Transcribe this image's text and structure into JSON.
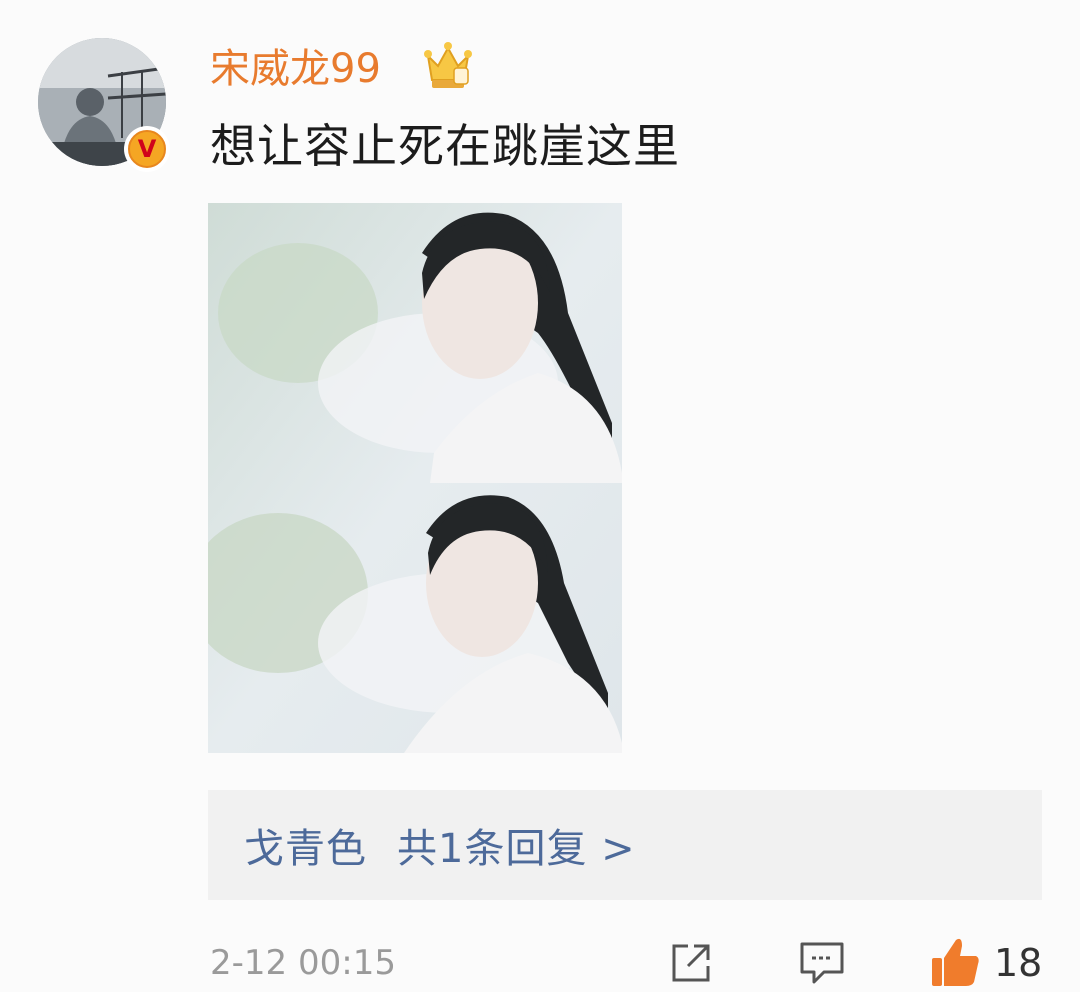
{
  "comment": {
    "username": "宋威龙99",
    "text": "想让容止死在跳崖这里",
    "verified_mark": "V"
  },
  "reply": {
    "author": "戈青色",
    "summary": "共1条回复 >"
  },
  "footer": {
    "timestamp": "2-12 00:15",
    "like_count": "18"
  },
  "icons": {
    "share": "share-icon",
    "comment": "comment-icon",
    "like": "thumbs-up-icon",
    "vip": "crown-icon",
    "verified": "verified-v-icon"
  },
  "colors": {
    "username": "#e87b2e",
    "reply_link": "#4d6a9a",
    "like_icon": "#f07c2c",
    "verified": "#f5a623"
  }
}
